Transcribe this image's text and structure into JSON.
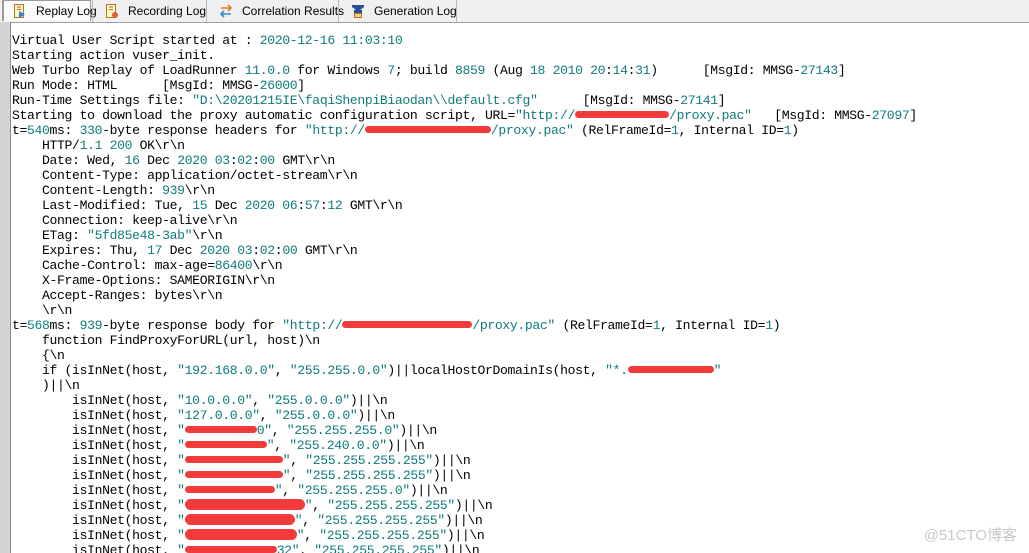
{
  "tabs": [
    {
      "label": "Replay Log",
      "icon": "replay-log-icon",
      "active": true
    },
    {
      "label": "Recording Log",
      "icon": "recording-log-icon",
      "active": false
    },
    {
      "label": "Correlation Results",
      "icon": "correlation-results-icon",
      "active": false
    },
    {
      "label": "Generation Log",
      "icon": "generation-log-icon",
      "active": false
    }
  ],
  "log": {
    "l01": {
      "a": "Virtual User Script started at : ",
      "b": "2020-12-16 11:03:10"
    },
    "l02": {
      "a": "Starting action vuser_init."
    },
    "l03": {
      "a": "Web Turbo Replay of LoadRunner ",
      "b": "11.0.0",
      "c": " for Windows ",
      "d": "7",
      "e": "; build ",
      "f": "8859",
      "g": " (Aug ",
      "h": "18 2010 20",
      "i": ":",
      "j": "14",
      "k": ":",
      "l": "31",
      "m": ")      [MsgId: MMSG-",
      "o": "27143",
      "p": "]"
    },
    "l04": {
      "a": "Run Mode: HTML      [MsgId: MMSG-",
      "b": "26000",
      "c": "]"
    },
    "l05": {
      "a": "Run-Time Settings file: ",
      "b": "\"D:\\20201215IE\\faqiShenpiBiaodan\\\\default.cfg\"",
      "c": "      [MsgId: MMSG-",
      "d": "27141",
      "e": "]"
    },
    "l06": {
      "a": "Starting to download the proxy automatic configuration script, URL=",
      "b": "\"http://",
      "c": "/proxy.pac\"",
      "d": "   [MsgId: MMSG-",
      "e": "27097",
      "f": "]"
    },
    "l07": {
      "a": "t=",
      "b": "540",
      "c": "ms: ",
      "d": "330",
      "e": "-byte response headers for ",
      "f": "\"http://",
      "g": "/proxy.pac\"",
      "h": " (RelFrameId=",
      "i": "1",
      "j": ", Internal ID=",
      "k": "1",
      "l": ")"
    },
    "l08": {
      "a": "    HTTP/",
      "b": "1.1 200",
      "c": " OK\\r\\n"
    },
    "l09": {
      "a": "    Date: Wed, ",
      "b": "16",
      "c": " Dec ",
      "d": "2020 03",
      "e": ":",
      "f": "02",
      "g": ":",
      "h": "00",
      "i": " GMT\\r\\n"
    },
    "l10": {
      "a": "    Content-Type: application/octet-stream\\r\\n"
    },
    "l11": {
      "a": "    Content-Length: ",
      "b": "939",
      "c": "\\r\\n"
    },
    "l12": {
      "a": "    Last-Modified: Tue, ",
      "b": "15",
      "c": " Dec ",
      "d": "2020 06",
      "e": ":",
      "f": "57",
      "g": ":",
      "h": "12",
      "i": " GMT\\r\\n"
    },
    "l13": {
      "a": "    Connection: keep-alive\\r\\n"
    },
    "l14": {
      "a": "    ETag: ",
      "b": "\"5fd85e48-3ab\"",
      "c": "\\r\\n"
    },
    "l15": {
      "a": "    Expires: Thu, ",
      "b": "17",
      "c": " Dec ",
      "d": "2020 03",
      "e": ":",
      "f": "02",
      "g": ":",
      "h": "00",
      "i": " GMT\\r\\n"
    },
    "l16": {
      "a": "    Cache-Control: max-age=",
      "b": "86400",
      "c": "\\r\\n"
    },
    "l17": {
      "a": "    X-Frame-Options: SAMEORIGIN\\r\\n"
    },
    "l18": {
      "a": "    Accept-Ranges: bytes\\r\\n"
    },
    "l19": {
      "a": "    \\r\\n"
    },
    "l20": {
      "a": "t=",
      "b": "568",
      "c": "ms: ",
      "d": "939",
      "e": "-byte response body for ",
      "f": "\"http://",
      "g": "/proxy.pac\"",
      "h": " (RelFrameId=",
      "i": "1",
      "j": ", Internal ID=",
      "k": "1",
      "l": ")"
    },
    "l21": {
      "a": "    function FindProxyForURL(url, host)\\n"
    },
    "l22": {
      "a": "    {\\n"
    },
    "l23": {
      "a": "    if (isInNet(host, ",
      "b": "\"192.168.0.0\"",
      "c": ", ",
      "d": "\"255.255.0.0\"",
      "e": ")||localHostOrDomainIs(host, ",
      "f": "\"*.",
      "g": "\""
    },
    "l24": {
      "a": "    )||\\n"
    },
    "l25": {
      "a": "        isInNet(host, ",
      "b": "\"10.0.0.0\"",
      "c": ", ",
      "d": "\"255.0.0.0\"",
      "e": ")||\\n"
    },
    "l26": {
      "a": "        isInNet(host, ",
      "b": "\"127.0.0.0\"",
      "c": ", ",
      "d": "\"255.0.0.0\"",
      "e": ")||\\n"
    },
    "l27": {
      "a": "        isInNet(host, ",
      "b": "\"",
      "c": "0\"",
      "d": ", ",
      "e": "\"255.255.255.0\"",
      "f": ")||\\n"
    },
    "l28": {
      "a": "        isInNet(host, ",
      "b": "\"",
      "c": "\"",
      "d": ", ",
      "e": "\"255.240.0.0\"",
      "f": ")||\\n"
    },
    "l29": {
      "a": "        isInNet(host, ",
      "b": "\"",
      "c": "\"",
      "d": ", ",
      "e": "\"255.255.255.255\"",
      "f": ")||\\n"
    },
    "l30": {
      "a": "        isInNet(host, ",
      "b": "\"",
      "c": "\"",
      "d": ", ",
      "e": "\"255.255.255.255\"",
      "f": ")||\\n"
    },
    "l31": {
      "a": "        isInNet(host, ",
      "b": "\"",
      "c": "\"",
      "d": ", ",
      "e": "\"255.255.255.0\"",
      "f": ")||\\n"
    },
    "l32": {
      "a": "        isInNet(host, ",
      "b": "\"",
      "c": "\"",
      "d": ", ",
      "e": "\"255.255.255.255\"",
      "f": ")||\\n"
    },
    "l33": {
      "a": "        isInNet(host, ",
      "b": "\"",
      "c": "\"",
      "d": ", ",
      "e": "\"255.255.255.255\"",
      "f": ")||\\n"
    },
    "l34": {
      "a": "        isInNet(host, ",
      "b": "\"",
      "c": "\"",
      "d": ", ",
      "e": "\"255.255.255.255\"",
      "f": ")||\\n"
    },
    "l35": {
      "a": "        isInNet(host, ",
      "b": "\"",
      "c": "32\"",
      "d": ", ",
      "e": "\"255.255.255.255\"",
      "f": ")||\\n"
    }
  },
  "watermark": "@51CTO博客",
  "colors": {
    "number": "#0e7c7b",
    "redaction": "#f43b3b"
  }
}
